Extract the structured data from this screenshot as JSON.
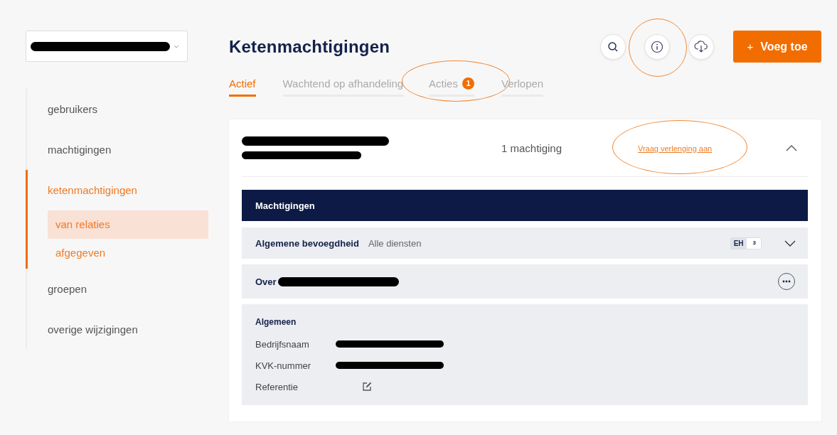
{
  "account_select": {
    "redacted": true
  },
  "sidebar": {
    "items": [
      {
        "label": "gebruikers",
        "selected": false,
        "expanded": false
      },
      {
        "label": "machtigingen",
        "selected": false,
        "expanded": false
      },
      {
        "label": "ketenmachtigingen",
        "selected": true,
        "expanded": true,
        "children": [
          {
            "label": "van relaties",
            "selected": true
          },
          {
            "label": "afgegeven",
            "selected": false
          }
        ]
      },
      {
        "label": "groepen",
        "selected": false,
        "expanded": false
      },
      {
        "label": "overige wijzigingen",
        "selected": false,
        "expanded": false
      }
    ]
  },
  "page_title": "Ketenmachtigingen",
  "toolbar": {
    "icon_buttons": [
      {
        "kind": "search",
        "circled": false
      },
      {
        "kind": "info",
        "circled": true
      },
      {
        "kind": "download",
        "circled": false
      }
    ],
    "add_button": {
      "icon": "+",
      "label": "Voeg toe"
    }
  },
  "tabs": [
    {
      "label": "Actief",
      "selected": true,
      "circled": false
    },
    {
      "label": "Wachtend op afhandeling",
      "selected": false,
      "circled": false
    },
    {
      "label": "Acties",
      "selected": false,
      "badge": "1",
      "circled": true
    },
    {
      "label": "Verlopen",
      "selected": false,
      "circled": false
    }
  ],
  "card": {
    "name_redacted": true,
    "count": "1 machtiging",
    "link": {
      "label": "Vraag verlenging aan",
      "circled": true
    },
    "expanded": true,
    "table_header": "Machtigingen",
    "permission": {
      "title": "Algemene bevoegdheid",
      "scope": "Alle diensten",
      "badge_label": "EH",
      "badge_value": "3",
      "expanded": false
    },
    "over": {
      "label": "Over",
      "redacted": true
    },
    "details": {
      "heading": "Algemeen",
      "fields": [
        {
          "label": "Bedrijfsnaam",
          "kind": "redacted"
        },
        {
          "label": "KVK-nummer",
          "kind": "redacted"
        },
        {
          "label": "Referentie",
          "kind": "edit"
        }
      ]
    }
  }
}
